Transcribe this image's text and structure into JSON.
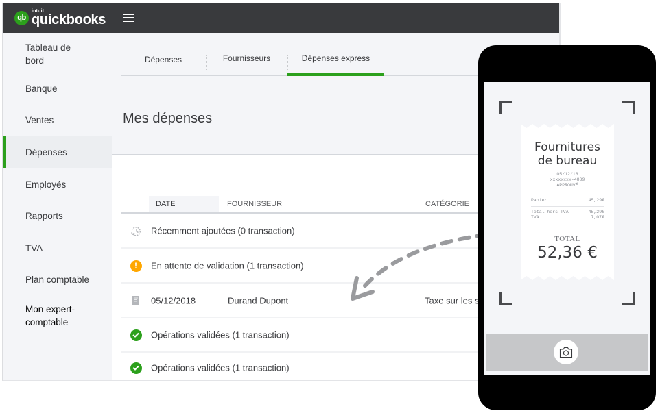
{
  "brand": {
    "logo_mark": "qb",
    "intuit": "intuit",
    "name": "quickbooks",
    "accent_color": "#2ca01c",
    "topbar_color": "#393a3d"
  },
  "sidebar": {
    "items": [
      {
        "label": "Tableau de bord",
        "active": false
      },
      {
        "label": "Banque",
        "active": false
      },
      {
        "label": "Ventes",
        "active": false
      },
      {
        "label": "Dépenses",
        "active": true
      },
      {
        "label": "Employés",
        "active": false
      },
      {
        "label": "Rapports",
        "active": false
      },
      {
        "label": "TVA",
        "active": false
      },
      {
        "label": "Plan comptable",
        "active": false
      },
      {
        "label": "Mon expert-comptable",
        "active": false
      }
    ]
  },
  "tabs": [
    {
      "label": "Dépenses",
      "active": false
    },
    {
      "label": "Fournisseurs",
      "active": false
    },
    {
      "label": "Dépenses express",
      "active": true
    }
  ],
  "page_title": "Mes dépenses",
  "table": {
    "columns": [
      "DATE",
      "FOURNISSEUR",
      "CATÉGORIE"
    ],
    "rows": [
      {
        "type": "group",
        "icon": "history-icon",
        "text": "Récemment ajoutées (0 transaction)"
      },
      {
        "type": "group",
        "icon": "warning-icon",
        "icon_symbol": "!",
        "text": "En attente de validation (1 transaction)"
      },
      {
        "type": "transaction",
        "icon": "receipt-icon",
        "date": "05/12/2018",
        "supplier": "Durand Dupont",
        "category": "Taxe sur les s"
      },
      {
        "type": "group",
        "icon": "check-circle-icon",
        "text": "Opérations validées (1 transaction)"
      },
      {
        "type": "group",
        "icon": "check-circle-icon",
        "text": "Opérations validées (1 transaction)"
      }
    ],
    "status_colors": {
      "warning": "#ffa700",
      "validated": "#2ca01c"
    }
  },
  "phone": {
    "receipt": {
      "title_line1": "Fournitures",
      "title_line2": "de bureau",
      "date": "05/12/18",
      "card": "xxxxxxxx-4839",
      "status": "APPROUVÉ",
      "items": [
        {
          "label": "Papier",
          "amount": "45,29€"
        }
      ],
      "subtotal_label": "Total hors TVA",
      "subtotal_amount": "45,29€",
      "tax_label": "TVA",
      "tax_amount": "7,07€",
      "total_label": "TOTAL",
      "total_amount": "52,36 €"
    },
    "camera_button": "camera-icon"
  }
}
